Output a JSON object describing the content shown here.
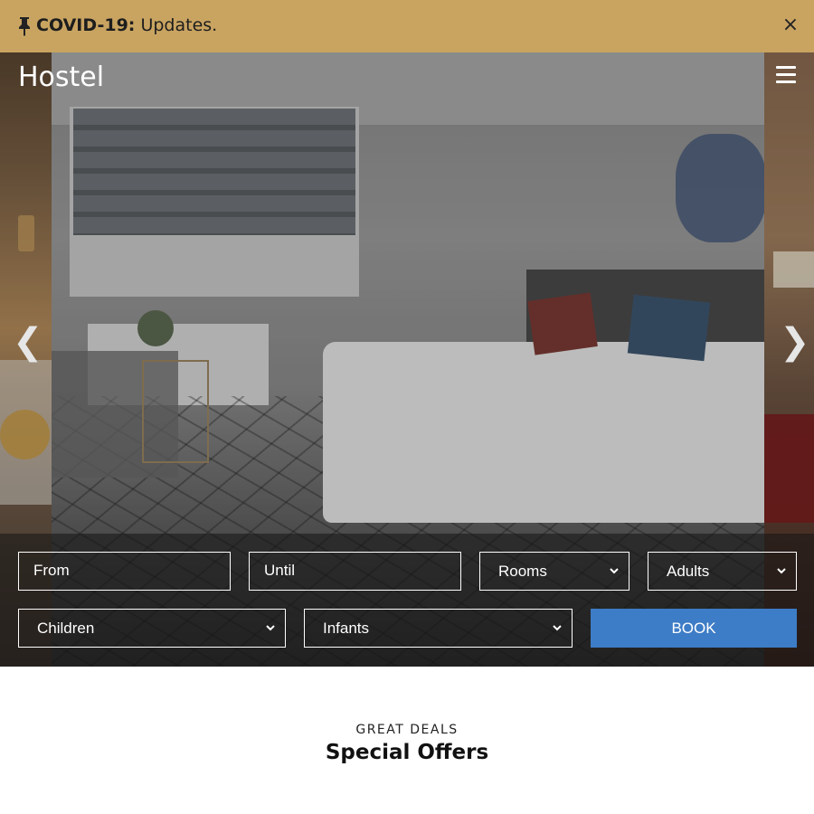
{
  "announcement": {
    "label": "COVID-19:",
    "text": " Updates.",
    "close_symbol": "×",
    "icon": "pin-icon",
    "background": "#c9a461"
  },
  "header": {
    "brand": "Hostel",
    "menu_icon": "hamburger-menu-icon"
  },
  "carousel": {
    "prev_symbol": "❮",
    "next_symbol": "❯"
  },
  "booking": {
    "from_placeholder": "From",
    "until_placeholder": "Until",
    "rooms": "Rooms",
    "adults": "Adults",
    "children": "Children",
    "infants": "Infants",
    "book_label": "BOOK",
    "button_color": "#3d7cc6"
  },
  "offers": {
    "eyebrow": "GREAT DEALS",
    "title": "Special Offers"
  }
}
